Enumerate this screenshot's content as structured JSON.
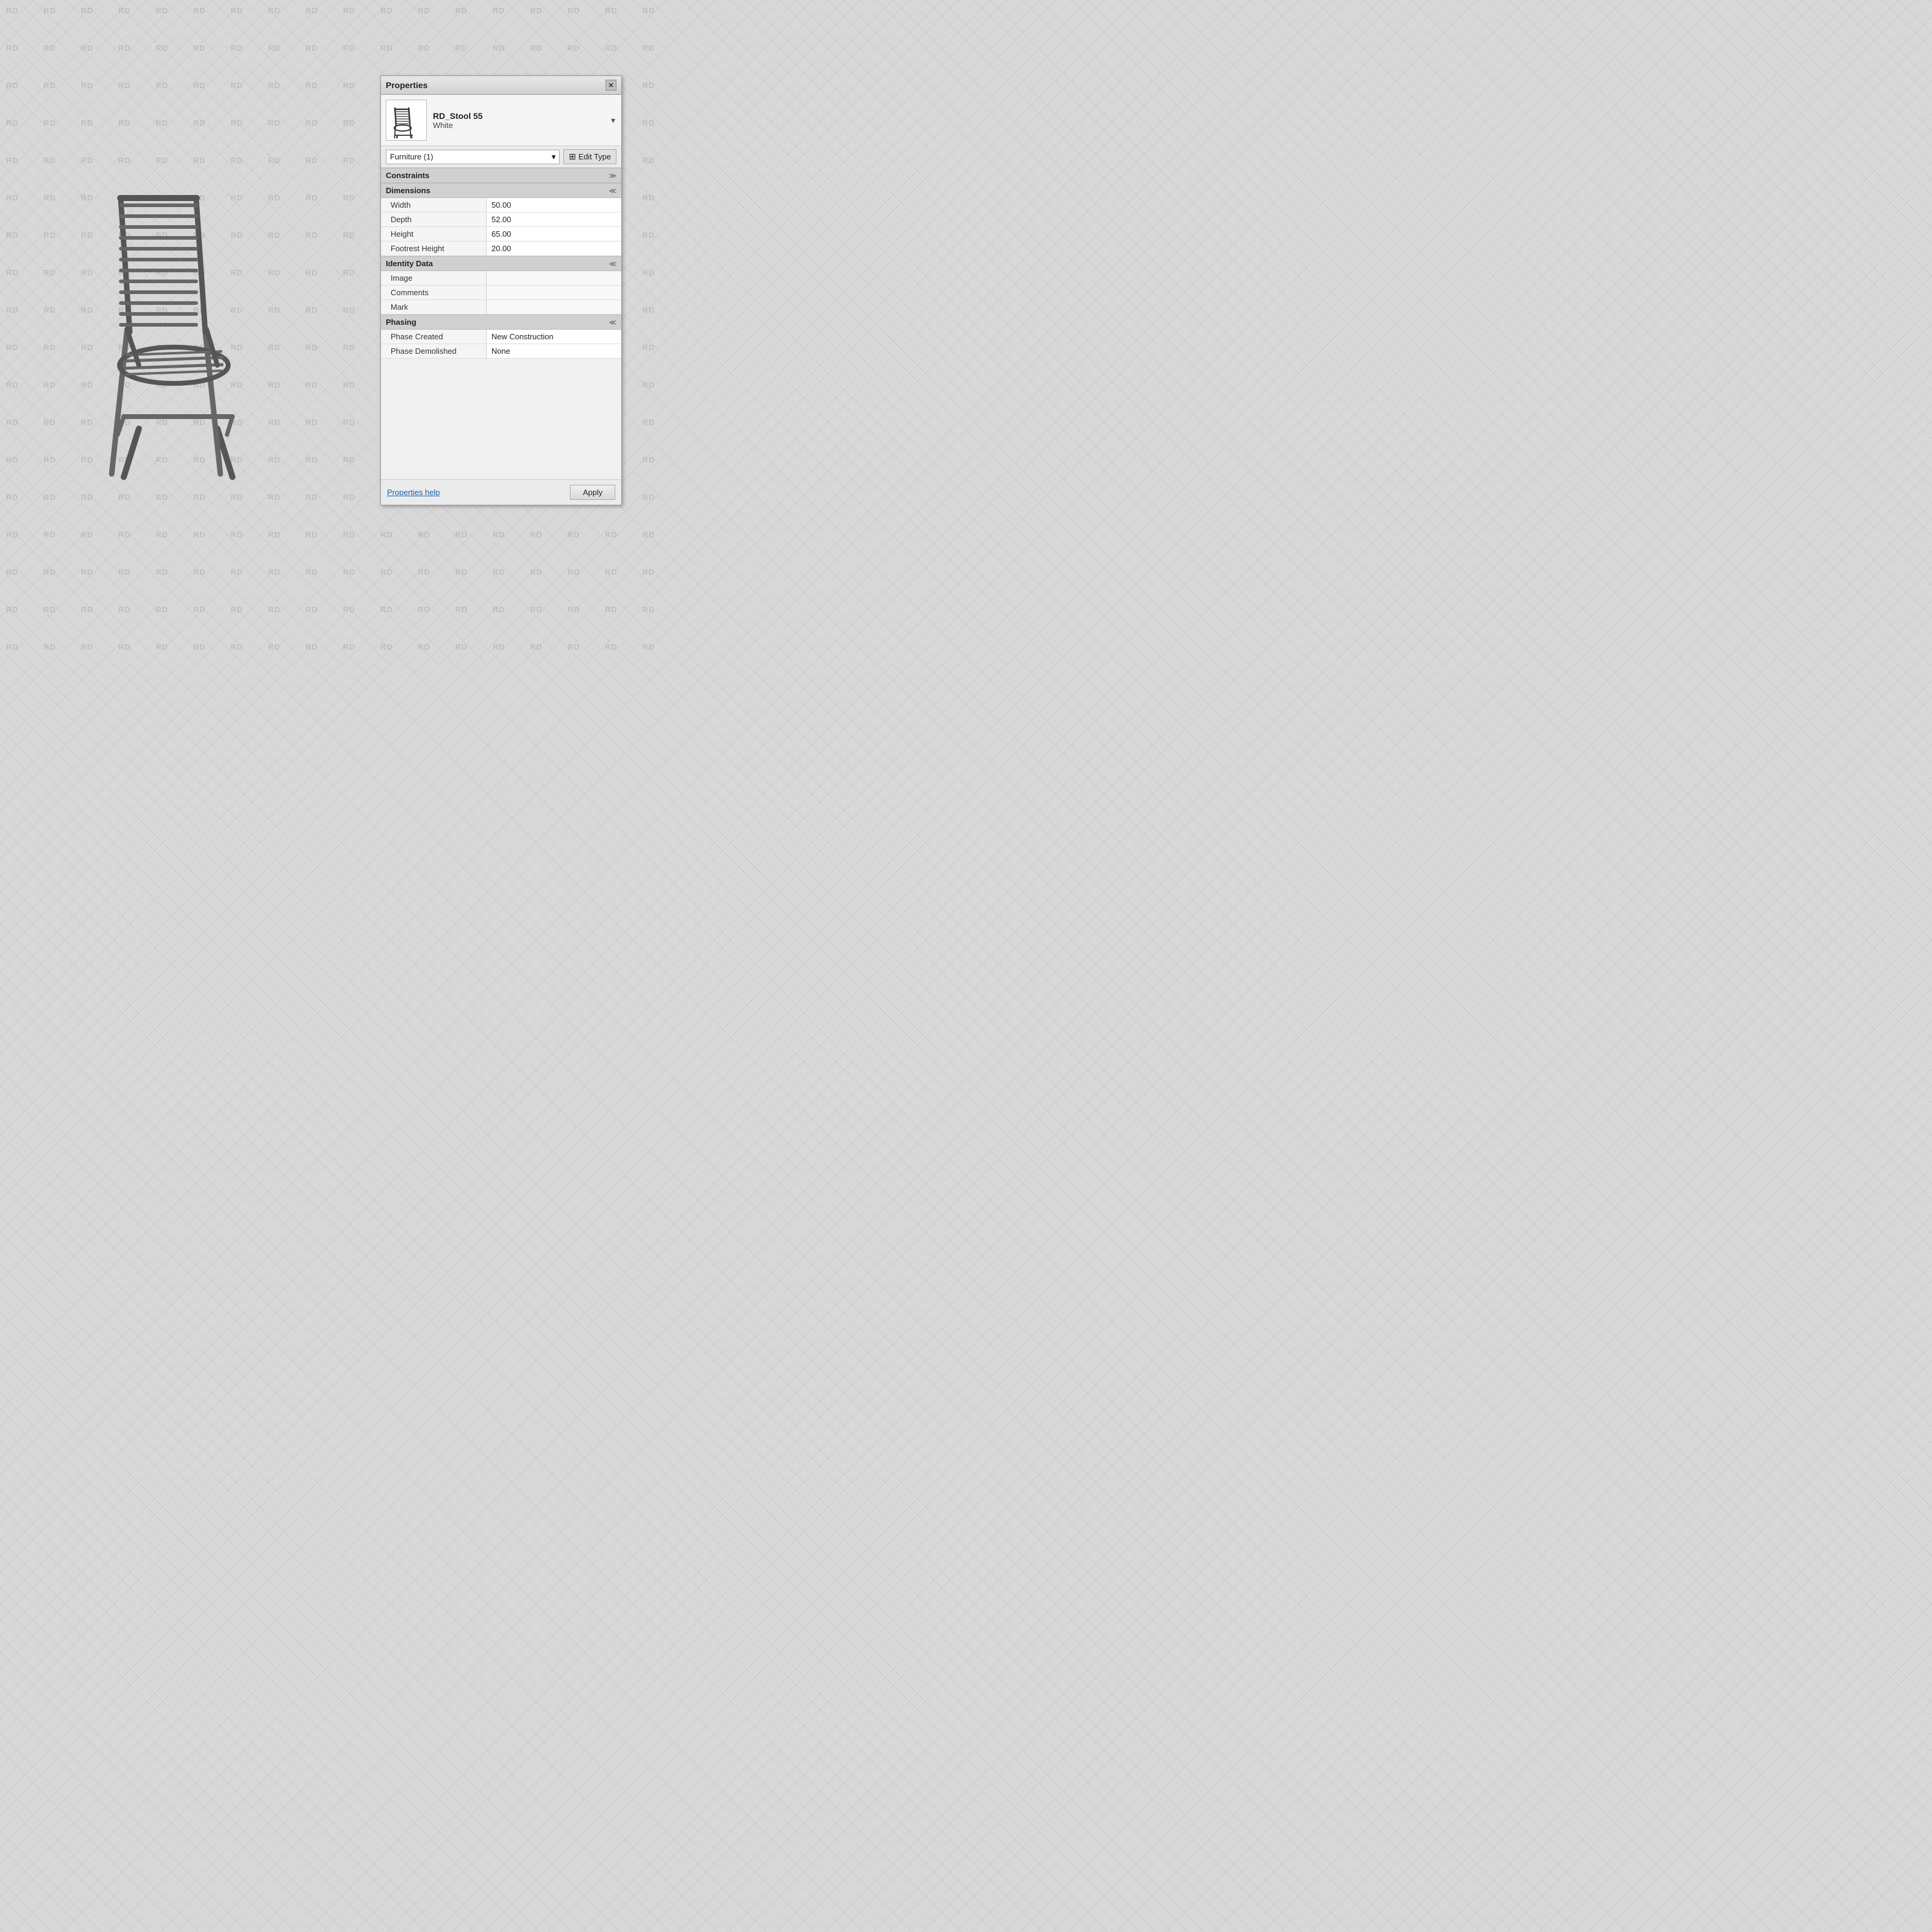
{
  "watermark": {
    "text": "RD"
  },
  "panel": {
    "title": "Properties",
    "close_label": "✕",
    "item": {
      "name": "RD_Stool 55",
      "subname": "White"
    },
    "selector": {
      "value": "Furniture (1)",
      "dropdown_arrow": "▾"
    },
    "edit_type_label": "Edit Type",
    "sections": [
      {
        "id": "constraints",
        "title": "Constraints",
        "collapsed": true,
        "toggle": "⋙",
        "properties": []
      },
      {
        "id": "dimensions",
        "title": "Dimensions",
        "collapsed": false,
        "toggle": "⋘",
        "properties": [
          {
            "label": "Width",
            "value": "50.00"
          },
          {
            "label": "Depth",
            "value": "52.00"
          },
          {
            "label": "Height",
            "value": "65.00"
          },
          {
            "label": "Footrest Height",
            "value": "20.00"
          }
        ]
      },
      {
        "id": "identity-data",
        "title": "Identity Data",
        "collapsed": false,
        "toggle": "⋘",
        "properties": [
          {
            "label": "Image",
            "value": ""
          },
          {
            "label": "Comments",
            "value": ""
          },
          {
            "label": "Mark",
            "value": ""
          }
        ]
      },
      {
        "id": "phasing",
        "title": "Phasing",
        "collapsed": false,
        "toggle": "⋘",
        "properties": [
          {
            "label": "Phase Created",
            "value": "New Construction"
          },
          {
            "label": "Phase Demolished",
            "value": "None"
          }
        ]
      }
    ],
    "footer": {
      "help_link": "Properties help",
      "apply_button": "Apply"
    }
  }
}
